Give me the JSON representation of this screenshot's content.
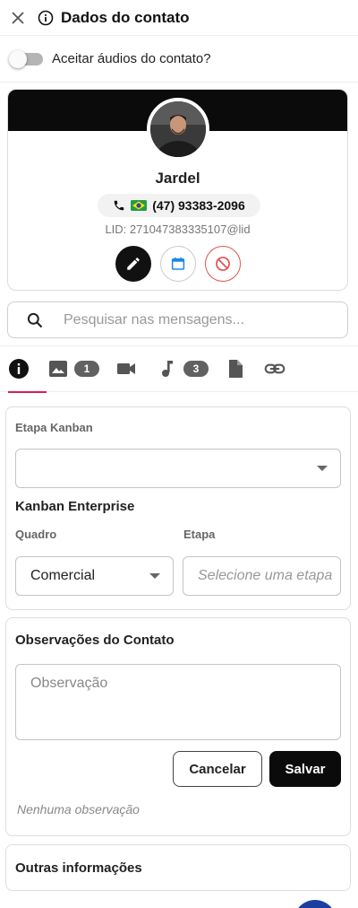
{
  "header": {
    "title": "Dados do contato"
  },
  "audio_toggle": {
    "label": "Aceitar áudios do contato?",
    "enabled": false
  },
  "profile": {
    "name": "Jardel",
    "phone": "(47) 93383-2096",
    "country_flag": "brazil-flag-icon",
    "lid": "LID: 271047383335107@lid",
    "banner_color": "#0b0b0b"
  },
  "search": {
    "placeholder": "Pesquisar nas mensagens..."
  },
  "tabs": [
    {
      "icon": "info-icon",
      "active": true
    },
    {
      "icon": "image-icon",
      "badge": "1"
    },
    {
      "icon": "video-icon"
    },
    {
      "icon": "music-icon",
      "badge": "3"
    },
    {
      "icon": "document-icon"
    },
    {
      "icon": "link-icon"
    }
  ],
  "kanban": {
    "stage_label": "Etapa Kanban",
    "stage_value": "",
    "enterprise_title": "Kanban Enterprise",
    "board_label": "Quadro",
    "board_value": "Comercial",
    "step_label": "Etapa",
    "step_placeholder": "Selecione uma etapa"
  },
  "observations": {
    "title": "Observações do Contato",
    "placeholder": "Observação",
    "cancel_label": "Cancelar",
    "save_label": "Salvar",
    "empty_text": "Nenhuma observação"
  },
  "other_info": {
    "title": "Outras informações"
  },
  "colors": {
    "accent": "#d81b60",
    "primary": "#0b0b0b",
    "danger": "#e05050",
    "calendar": "#1e88e5",
    "fab": "#1a3fa0"
  }
}
